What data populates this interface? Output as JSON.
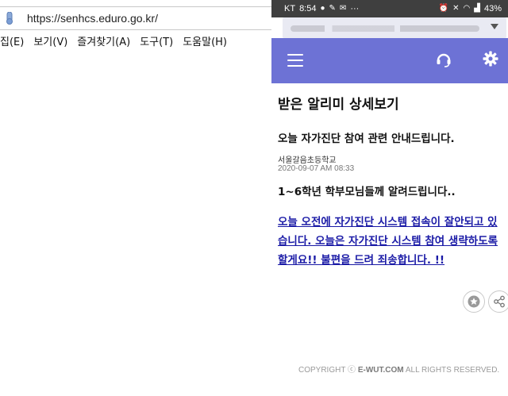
{
  "browser": {
    "url": "https://senhcs.eduro.go.kr/",
    "menu": [
      "집(E)",
      "보기(V)",
      "즐겨찾기(A)",
      "도구(T)",
      "도움말(H)"
    ]
  },
  "statusbar": {
    "carrier": "KT",
    "time": "8:54",
    "more": "···",
    "battery": "43%"
  },
  "page": {
    "title": "받은 알리미 상세보기",
    "message_title": "오늘 자가진단 참여 관련 안내드립니다.",
    "sender": "서울갈음초등학교",
    "date": "2020-09-07 AM 08:33",
    "greeting": "1~6학년 학부모님들께 알려드립니다..",
    "body": "오늘 오전에 자가진단 시스템 접속이 잘안되고 있습니다. 오늘은 자가진단 시스템 참여 생략하도록 할게요!! 불편을 드려 죄송합니다. !!"
  },
  "footer": {
    "prefix": "COPYRIGHT ⓒ ",
    "brand": "E-WUT.COM",
    "suffix": " ALL RIGHTS RESERVED."
  },
  "colors": {
    "header": "#6d72d5",
    "link": "#1a1aa6",
    "statusbar": "#3f3f3f"
  },
  "icons": {
    "menu": "hamburger-icon",
    "support": "headset-icon",
    "settings": "gear-icon",
    "favorite": "star-icon",
    "share": "share-icon"
  }
}
